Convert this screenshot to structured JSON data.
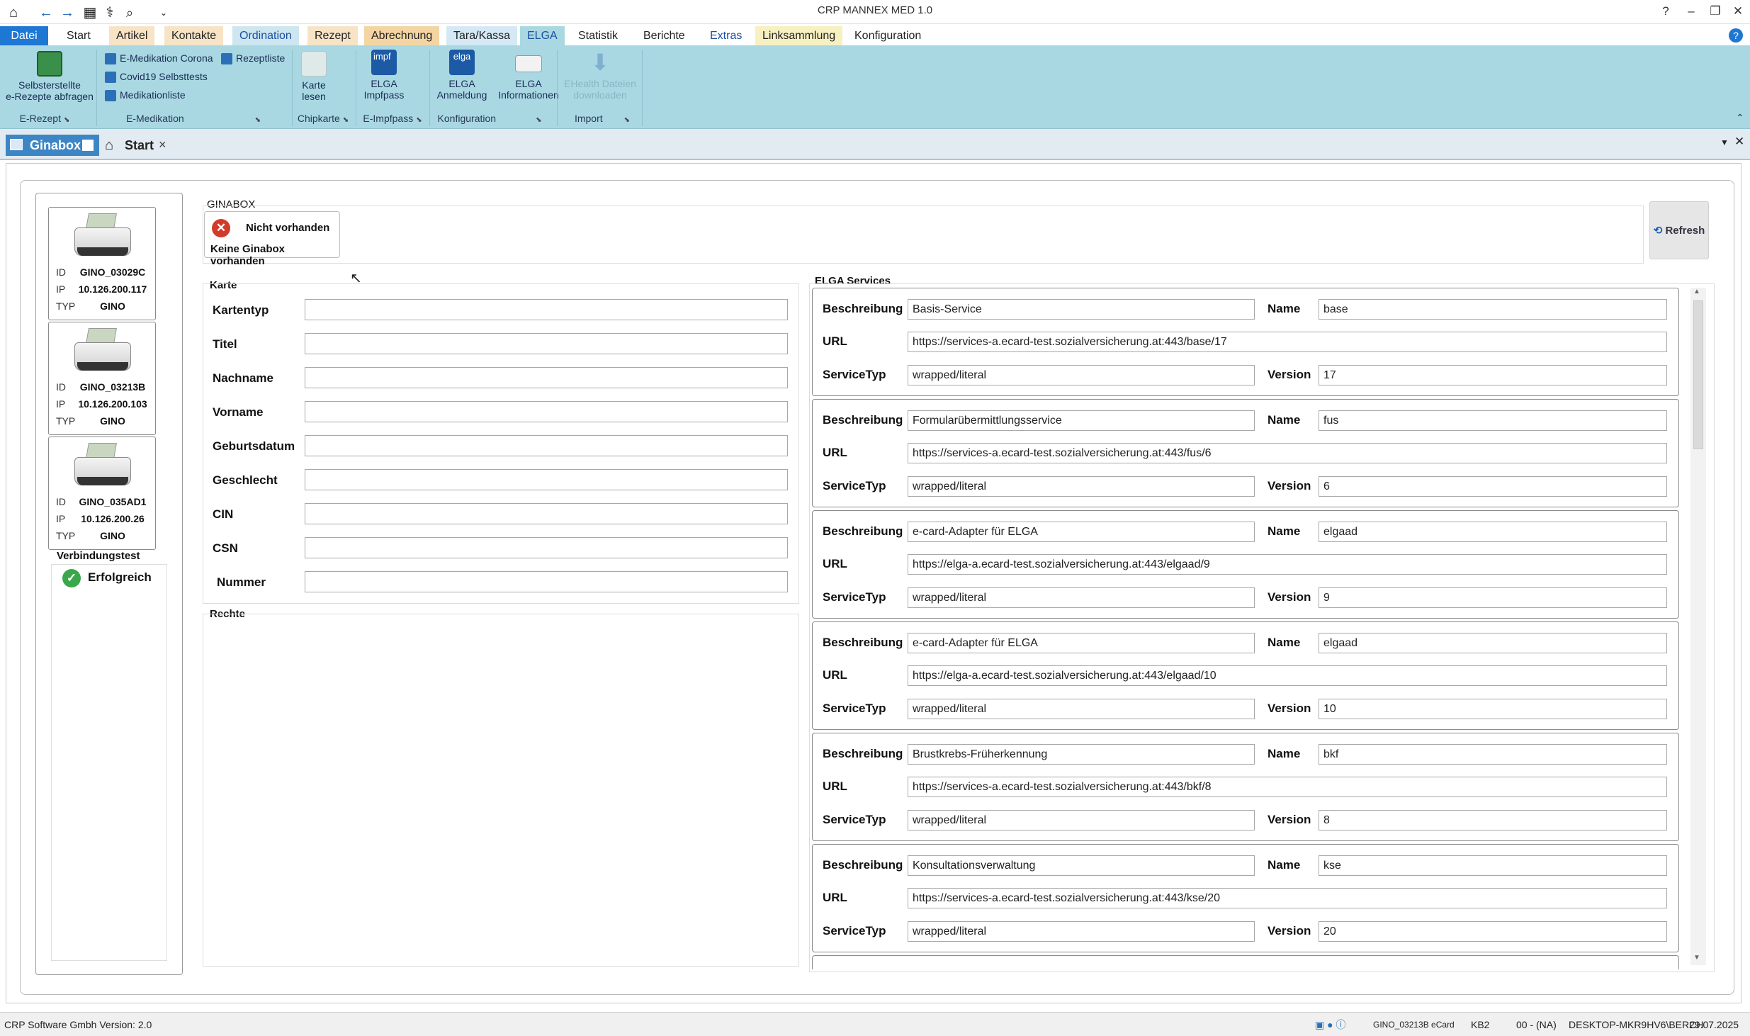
{
  "window": {
    "title": "CRP MANNEX MED 1.0",
    "help": "?",
    "minimize": "–",
    "maximize": "❐",
    "close": "✕"
  },
  "menu": {
    "tabs": [
      {
        "label": "Datei",
        "color": "#1e77d3"
      },
      {
        "label": "Start",
        "color": ""
      },
      {
        "label": "Artikel",
        "color": "#f7e3c6"
      },
      {
        "label": "Kontakte",
        "color": "#f7e3c6"
      },
      {
        "label": "Ordination",
        "color": "#cde6f0"
      },
      {
        "label": "Rezept",
        "color": "#f7e3c6"
      },
      {
        "label": "Abrechnung",
        "color": "#f4d5a2"
      },
      {
        "label": "Tara/Kassa",
        "color": "#d4e9f5"
      },
      {
        "label": "ELGA",
        "color": "#a9d8e2"
      },
      {
        "label": "Statistik",
        "color": ""
      },
      {
        "label": "Berichte",
        "color": ""
      },
      {
        "label": "Extras",
        "color": ""
      },
      {
        "label": "Linksammlung",
        "color": "#f7f0c0"
      },
      {
        "label": "Konfiguration",
        "color": ""
      }
    ]
  },
  "ribbon": {
    "erezept_btn": "Selbsterstellte\ne-Rezepte abfragen",
    "small_items": [
      "E-Medikation Corona",
      "Covid19 Selbsttests",
      "Medikationliste",
      "Rezeptliste"
    ],
    "karte_btn": "Karte\nlesen",
    "impfpass_btn": "ELGA\nImpfpass",
    "impf_icon_text": "impf",
    "anmeldung_btn": "ELGA\nAnmeldung",
    "elga_icon_text": "elga",
    "info_btn": "ELGA\nInformationen",
    "download_btn": "EHealth Dateien\ndownloaden",
    "groups": [
      "E-Rezept",
      "E-Medikation",
      "Chipkarte",
      "E-Impfpass",
      "Konfiguration",
      "Import"
    ]
  },
  "doctabs": {
    "ginabox": "Ginabox",
    "start": "Start",
    "close": "×"
  },
  "devices": [
    {
      "id": "GINO_03029C",
      "ip": "10.126.200.117",
      "typ": "GINO"
    },
    {
      "id": "GINO_03213B",
      "ip": "10.126.200.103",
      "typ": "GINO"
    },
    {
      "id": "GINO_035AD1",
      "ip": "10.126.200.26",
      "typ": "GINO"
    }
  ],
  "device_keys": {
    "id": "ID",
    "ip": "IP",
    "typ": "TYP"
  },
  "connection": {
    "title": "Verbindungstest",
    "status": "Erfolgreich"
  },
  "ginabox": {
    "title": "GINABOX",
    "status": "Nicht vorhanden",
    "message": "Keine Ginabox vorhanden",
    "refresh": "Refresh"
  },
  "karte": {
    "title": "Karte",
    "fields": [
      "Kartentyp",
      "Titel",
      "Nachname",
      "Vorname",
      "Geburtsdatum",
      "Geschlecht",
      "CIN",
      "CSN",
      "Nummer"
    ]
  },
  "rechte": {
    "title": "Rechte"
  },
  "elga_services": {
    "title": "ELGA Services",
    "labels": {
      "beschreibung": "Beschreibung",
      "name": "Name",
      "url": "URL",
      "servicetyp": "ServiceTyp",
      "version": "Version"
    },
    "items": [
      {
        "beschreibung": "Basis-Service",
        "name": "base",
        "url": "https://services-a.ecard-test.sozialversicherung.at:443/base/17",
        "servicetyp": "wrapped/literal",
        "version": "17"
      },
      {
        "beschreibung": "Formularübermittlungsservice",
        "name": "fus",
        "url": "https://services-a.ecard-test.sozialversicherung.at:443/fus/6",
        "servicetyp": "wrapped/literal",
        "version": "6"
      },
      {
        "beschreibung": "e-card-Adapter für ELGA",
        "name": "elgaad",
        "url": "https://elga-a.ecard-test.sozialversicherung.at:443/elgaad/9",
        "servicetyp": "wrapped/literal",
        "version": "9"
      },
      {
        "beschreibung": "e-card-Adapter für ELGA",
        "name": "elgaad",
        "url": "https://elga-a.ecard-test.sozialversicherung.at:443/elgaad/10",
        "servicetyp": "wrapped/literal",
        "version": "10"
      },
      {
        "beschreibung": "Brustkrebs-Früherkennung",
        "name": "bkf",
        "url": "https://services-a.ecard-test.sozialversicherung.at:443/bkf/8",
        "servicetyp": "wrapped/literal",
        "version": "8"
      },
      {
        "beschreibung": "Konsultationsverwaltung",
        "name": "kse",
        "url": "https://services-a.ecard-test.sozialversicherung.at:443/kse/20",
        "servicetyp": "wrapped/literal",
        "version": "20"
      }
    ]
  },
  "statusbar": {
    "left": "CRP Software Gmbh Version: 2.0",
    "card": "GINO_03213B eCard",
    "kb": "KB2",
    "na": "00 - (NA)",
    "machine": "DESKTOP-MKR9HV6\\BERCH",
    "date": "29.07.2025"
  }
}
